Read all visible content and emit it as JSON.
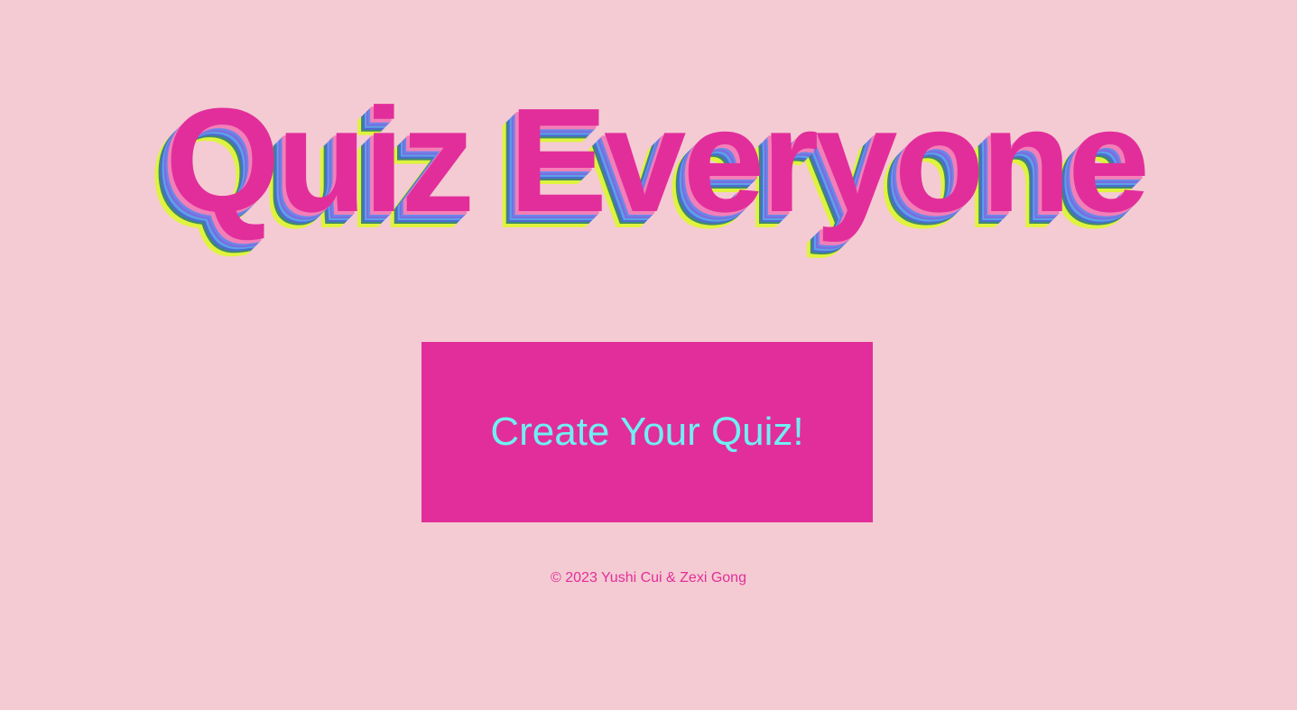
{
  "header": {
    "title": "Quiz Everyone"
  },
  "main": {
    "cta_label": "Create Your Quiz!"
  },
  "footer": {
    "copyright": "© 2023 Yushi Cui & Zexi Gong"
  },
  "colors": {
    "background": "#f4cbd2",
    "accent": "#e22e9b",
    "button_text": "#6ff0f0",
    "shadow_yellow": "#dff33e",
    "shadow_blue": "#6a87e8"
  }
}
